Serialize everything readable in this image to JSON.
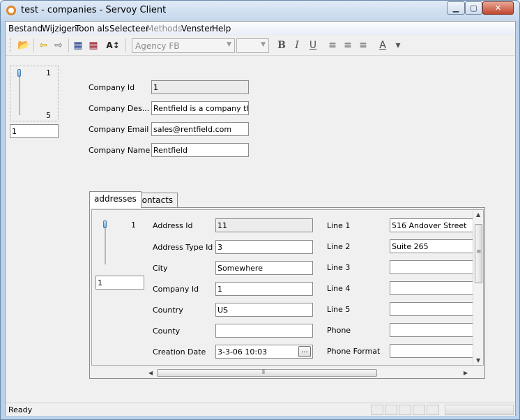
{
  "window": {
    "title": "test - companies - Servoy Client",
    "minimize": "▁",
    "maximize": "▢",
    "close": "✕"
  },
  "menu": [
    "Bestand",
    "Wijzigen",
    "Toon als",
    "Selecteer",
    "Methods",
    "Venster",
    "Help"
  ],
  "toolbar": {
    "font_name": "Agency FB",
    "font_size": "",
    "icons": {
      "open": "📂",
      "prev": "⇦",
      "next": "⇨",
      "new_record": "▦",
      "delete_record": "▦",
      "sort": "A↕",
      "bold": "B",
      "italic": "I",
      "underline": "U",
      "align_left": "≡",
      "align_center": "≡",
      "align_right": "≡",
      "font_color": "A",
      "dropdown": "▾"
    }
  },
  "form": {
    "record_slider": {
      "top": "1",
      "bottom": "5",
      "current": "1"
    },
    "fields": [
      {
        "label": "Company Id",
        "value": "1",
        "readonly": true
      },
      {
        "label": "Company Des...",
        "value": "Rentfield is a company that r",
        "readonly": false
      },
      {
        "label": "Company Email",
        "value": "sales@rentfield.com",
        "readonly": false
      },
      {
        "label": "Company Name",
        "value": "Rentfield",
        "readonly": false
      }
    ]
  },
  "tabs": [
    {
      "label": "addresses",
      "active": true
    },
    {
      "label": "contacts",
      "active": false
    }
  ],
  "addresses": {
    "record_slider": {
      "top": "1",
      "current": "1"
    },
    "left_fields": [
      {
        "label": "Address Id",
        "value": "11",
        "readonly": true
      },
      {
        "label": "Address Type Id",
        "value": "3",
        "readonly": false
      },
      {
        "label": "City",
        "value": "Somewhere",
        "readonly": false
      },
      {
        "label": "Company Id",
        "value": "1",
        "readonly": false
      },
      {
        "label": "Country",
        "value": "US",
        "readonly": false
      },
      {
        "label": "County",
        "value": "",
        "readonly": false
      },
      {
        "label": "Creation Date",
        "value": "3-3-06 10:03",
        "readonly": false
      }
    ],
    "date_button": "...",
    "right_fields": [
      {
        "label": "Line 1",
        "value": "516 Andover Street"
      },
      {
        "label": "Line 2",
        "value": "Suite 265"
      },
      {
        "label": "Line 3",
        "value": ""
      },
      {
        "label": "Line 4",
        "value": ""
      },
      {
        "label": "Line 5",
        "value": ""
      },
      {
        "label": "Phone",
        "value": ""
      },
      {
        "label": "Phone Format",
        "value": ""
      }
    ]
  },
  "status": {
    "text": "Ready"
  },
  "scroll": {
    "up": "▲",
    "down": "▼",
    "left": "◀",
    "right": "▶",
    "grip": "≡",
    "hgrip": "⦀"
  }
}
